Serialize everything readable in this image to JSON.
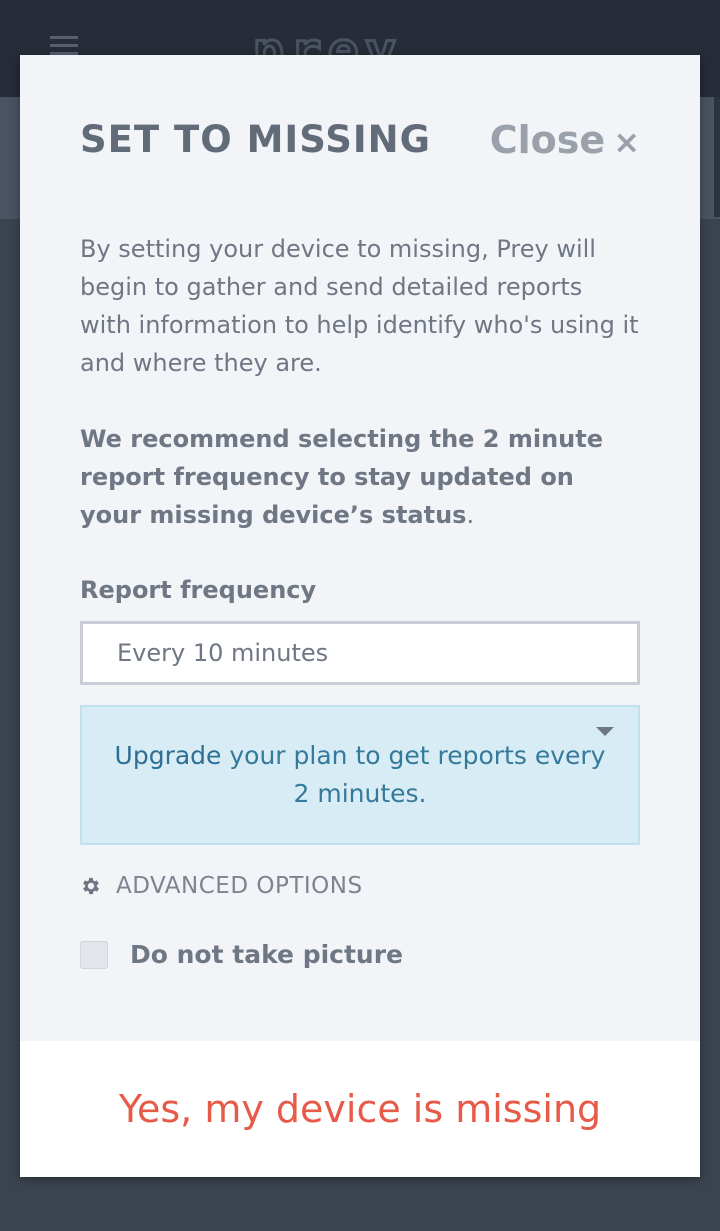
{
  "header": {
    "logo_text": "prey",
    "menu_icon": "hamburger-icon"
  },
  "modal": {
    "title": "SET TO MISSING",
    "close_label": "Close",
    "close_icon": "×",
    "intro": "By setting your device to missing, Prey will begin to gather and send detailed reports with information to help identify who's using it and where they are.",
    "recommendation_bold": "We recommend selecting the 2 minute report frequency to stay updated on your missing device’s status",
    "recommendation_tail": ".",
    "frequency_label": "Report frequency",
    "frequency_value": "Every 10 minutes",
    "upgrade_link": "Upgrade",
    "upgrade_rest": " your plan to get reports every 2 minutes.",
    "advanced_label": "ADVANCED OPTIONS",
    "advanced_icon": "gear-icon",
    "picture_label": "Do not take picture",
    "picture_checked": false,
    "confirm_label": "Yes, my device is missing"
  },
  "colors": {
    "accent_red": "#e85a48",
    "info_bg": "#d8ecf5",
    "info_text": "#35799b",
    "header_bg": "#262d38"
  }
}
